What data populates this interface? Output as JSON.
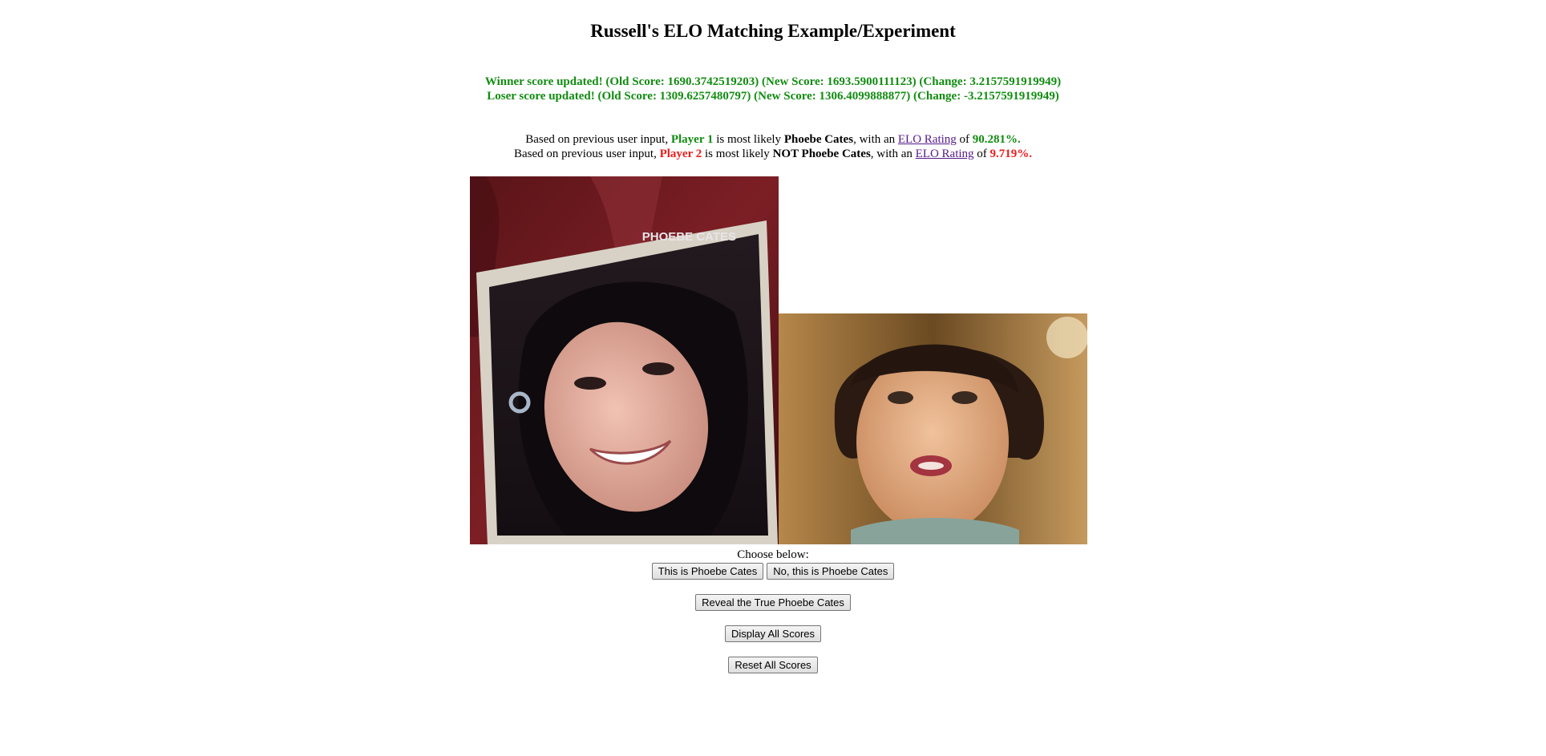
{
  "page": {
    "title": "Russell's ELO Matching Example/Experiment"
  },
  "status": {
    "winner_line": "Winner score updated! (Old Score: 1690.3742519203) (New Score: 1693.5900111123) (Change: 3.2157591919949)",
    "loser_line": "Loser score updated! (Old Score: 1309.6257480797) (New Score: 1306.4099888877) (Change: -3.2157591919949)"
  },
  "prediction": {
    "line1": {
      "prefix": "Based on previous user input, ",
      "player": "Player 1",
      "middle": " is most likely ",
      "target": "Phoebe Cates",
      "suffix": ", with an ",
      "link": "ELO Rating",
      "of": " of ",
      "percent": "90.281%."
    },
    "line2": {
      "prefix": "Based on previous user input, ",
      "player": "Player 2",
      "middle": " is most likely ",
      "target": "NOT Phoebe Cates",
      "suffix": ", with an ",
      "link": "ELO Rating",
      "of": " of ",
      "percent": "9.719%."
    }
  },
  "photos": {
    "left_caption": "PHOEBE CATES"
  },
  "choice": {
    "prompt": "Choose below:",
    "player1_button": "This is Phoebe Cates",
    "player2_button": "No, this is Phoebe Cates",
    "reveal_button": "Reveal the True Phoebe Cates",
    "display_button": "Display All Scores",
    "reset_button": "Reset All Scores"
  },
  "colors": {
    "winner": "#118c11",
    "loser": "#ee1c1c",
    "link": "#551a8b"
  }
}
